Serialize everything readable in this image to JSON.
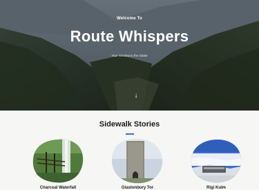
{
  "hero": {
    "pre_title": "Welcome To",
    "title": "Route Whispers",
    "subtitle": "Your Window to the Globe",
    "scroll_icon": "arrow-down-icon"
  },
  "section": {
    "title": "Sidewalk Stories",
    "accent_color": "#3a6fd8"
  },
  "cards": [
    {
      "label": "Charcoal Waterfall",
      "image": "waterfall-forest-bridge"
    },
    {
      "label": "Glastonbury Tor",
      "image": "stone-tower"
    },
    {
      "label": "Rigi Kulm",
      "image": "mountain-summit-sea-of-clouds"
    }
  ]
}
